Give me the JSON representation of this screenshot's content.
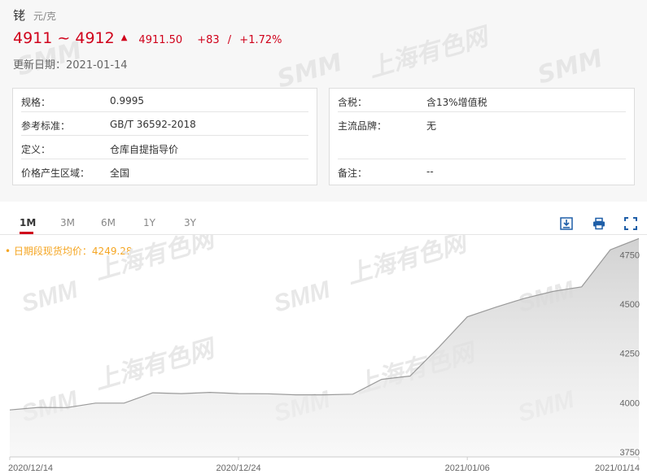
{
  "product": {
    "name": "铑",
    "unit": "元/克"
  },
  "price": {
    "range": "4911 ~ 4912",
    "average": "4911.50",
    "change": "+83",
    "separator": "/",
    "change_pct": "+1.72%"
  },
  "update": {
    "label": "更新日期：",
    "date": "2021-01-14"
  },
  "specs_left": [
    {
      "key": "规格：",
      "value": "0.9995"
    },
    {
      "key": "参考标准：",
      "value": "GB/T 36592-2018"
    },
    {
      "key": "定义：",
      "value": "仓库自提指导价"
    },
    {
      "key": "价格产生区域：",
      "value": "全国"
    }
  ],
  "specs_right": [
    {
      "key": "含税：",
      "value": "含13%增值税"
    },
    {
      "key": "主流品牌：",
      "value": "无"
    },
    {
      "key": "备注：",
      "value": "--"
    }
  ],
  "tabs": [
    "1M",
    "3M",
    "6M",
    "1Y",
    "3Y"
  ],
  "active_tab": "1M",
  "toolbar": {
    "download": "download-icon",
    "print": "print-icon",
    "fullscreen": "fullscreen-icon"
  },
  "watermark": {
    "logo": "SMM",
    "text": "上海有色网"
  },
  "legend": {
    "marker": "•",
    "label": "日期段现货均价：",
    "value": "4249.28"
  },
  "colors": {
    "price_red": "#d0021b",
    "legend_orange": "#f5a623",
    "line": "#9a9a9a",
    "tab_underline": "#d0021b"
  },
  "chart_data": {
    "type": "area",
    "x": [
      "2020/12/14",
      "2020/12/15",
      "2020/12/16",
      "2020/12/17",
      "2020/12/18",
      "2020/12/21",
      "2020/12/22",
      "2020/12/23",
      "2020/12/24",
      "2020/12/25",
      "2020/12/28",
      "2020/12/29",
      "2020/12/30",
      "2020/12/31",
      "2021/01/04",
      "2021/01/05",
      "2021/01/06",
      "2021/01/07",
      "2021/01/08",
      "2021/01/11",
      "2021/01/12",
      "2021/01/13",
      "2021/01/14"
    ],
    "series": [
      {
        "values": [
          3963,
          3976,
          3975,
          3998,
          3998,
          4050,
          4046,
          4052,
          4046,
          4045,
          4040,
          4040,
          4043,
          4118,
          4135,
          4280,
          4435,
          4484,
          4529,
          4564,
          4587,
          4775,
          4832
        ]
      }
    ],
    "x_ticks": [
      "2020/12/14",
      "2020/12/24",
      "2021/01/06",
      "2021/01/14"
    ],
    "y_ticks": [
      3750,
      4000,
      4250,
      4500,
      4750
    ],
    "ylim": [
      3725,
      4850
    ],
    "grid": false
  }
}
